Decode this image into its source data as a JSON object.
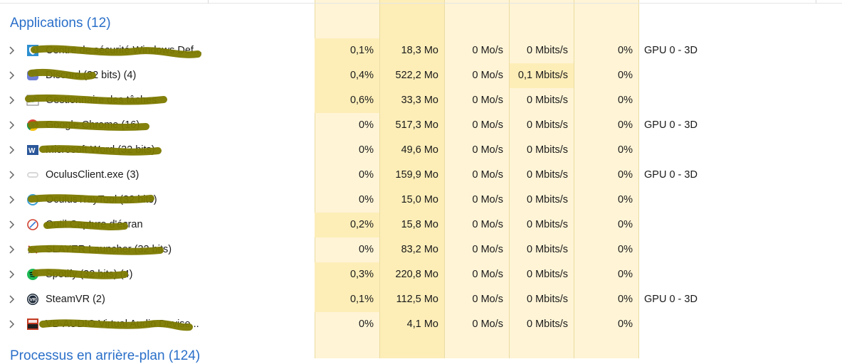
{
  "groups": {
    "applications": "Applications (12)",
    "background": "Processus en arrière-plan (124)"
  },
  "colors": {
    "heat_light": "#fff4d6",
    "heat_mid": "#fdeeb8",
    "heat_high": "#f9e1a0",
    "header_blue": "#2a6fc9",
    "scribble": "#7d7a00"
  },
  "rows": [
    {
      "name": "Centre de sécurité Windows Def...",
      "icon": "shield-icon",
      "cpu": "0,1%",
      "memory": "18,3 Mo",
      "disk": "0 Mo/s",
      "network": "0 Mbits/s",
      "gpu": "0%",
      "gpu_engine": "GPU 0 - 3D"
    },
    {
      "name": "Discord (32 bits) (4)",
      "icon": "discord-icon",
      "cpu": "0,4%",
      "memory": "522,2 Mo",
      "disk": "0 Mo/s",
      "network": "0,1 Mbits/s",
      "gpu": "0%",
      "gpu_engine": ""
    },
    {
      "name": "Gestionnaire des tâches",
      "icon": "task-manager-icon",
      "cpu": "0,6%",
      "memory": "33,3 Mo",
      "disk": "0 Mo/s",
      "network": "0 Mbits/s",
      "gpu": "0%",
      "gpu_engine": ""
    },
    {
      "name": "Google Chrome (16)",
      "icon": "chrome-icon",
      "cpu": "0%",
      "memory": "517,3 Mo",
      "disk": "0 Mo/s",
      "network": "0 Mbits/s",
      "gpu": "0%",
      "gpu_engine": "GPU 0 - 3D"
    },
    {
      "name": "Microsoft Word (32 bits)",
      "icon": "word-icon",
      "cpu": "0%",
      "memory": "49,6 Mo",
      "disk": "0 Mo/s",
      "network": "0 Mbits/s",
      "gpu": "0%",
      "gpu_engine": ""
    },
    {
      "name": "OculusClient.exe (3)",
      "icon": "oculus-icon",
      "cpu": "0%",
      "memory": "159,9 Mo",
      "disk": "0 Mo/s",
      "network": "0 Mbits/s",
      "gpu": "0%",
      "gpu_engine": "GPU 0 - 3D"
    },
    {
      "name": "OculusTrayTool (32 bits)",
      "icon": "tray-tool-icon",
      "cpu": "0%",
      "memory": "15,0 Mo",
      "disk": "0 Mo/s",
      "network": "0 Mbits/s",
      "gpu": "0%",
      "gpu_engine": ""
    },
    {
      "name": "Outil Capture d'écran",
      "icon": "snipping-tool-icon",
      "cpu": "0,2%",
      "memory": "15,8 Mo",
      "disk": "0 Mo/s",
      "network": "0 Mbits/s",
      "gpu": "0%",
      "gpu_engine": ""
    },
    {
      "name": "SLAYER Launcher (32 bits)",
      "icon": "launcher-icon",
      "cpu": "0%",
      "memory": "83,2 Mo",
      "disk": "0 Mo/s",
      "network": "0 Mbits/s",
      "gpu": "0%",
      "gpu_engine": ""
    },
    {
      "name": "Spotify (32 bits) (4)",
      "icon": "spotify-icon",
      "cpu": "0,3%",
      "memory": "220,8 Mo",
      "disk": "0 Mo/s",
      "network": "0 Mbits/s",
      "gpu": "0%",
      "gpu_engine": ""
    },
    {
      "name": "SteamVR (2)",
      "icon": "steamvr-icon",
      "cpu": "0,1%",
      "memory": "112,5 Mo",
      "disk": "0 Mo/s",
      "network": "0 Mbits/s",
      "gpu": "0%",
      "gpu_engine": "GPU 0 - 3D"
    },
    {
      "name": "VB-AUDIO Virtual Audio Devise...",
      "icon": "voicemeeter-icon",
      "cpu": "0%",
      "memory": "4,1 Mo",
      "disk": "0 Mo/s",
      "network": "0 Mbits/s",
      "gpu": "0%",
      "gpu_engine": ""
    }
  ]
}
